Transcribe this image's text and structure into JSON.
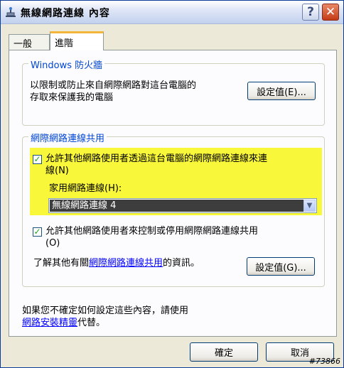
{
  "window": {
    "title": "無線網路連線 內容",
    "icon": "network-icon",
    "help_glyph": "?",
    "close_glyph": "✕"
  },
  "tabs": [
    {
      "label": "一般",
      "selected": false
    },
    {
      "label": "進階",
      "selected": true
    }
  ],
  "firewall": {
    "group_title": "Windows 防火牆",
    "description_line1": "以限制或防止來自網際網路對這台電腦的",
    "description_line2": "存取來保護我的電腦",
    "settings_button": "設定值(E)..."
  },
  "ics": {
    "group_title": "網際網路連線共用",
    "allow_sharing": {
      "checked": true,
      "label_line1": "允許其他網路使用者透過這台電腦的網際網路連線來連",
      "label_line2": "線(N)"
    },
    "home_network": {
      "label": "家用網路連線(H):",
      "selected_value": "無線網路連線 4"
    },
    "allow_control": {
      "checked": true,
      "label_line1": "允許其他網路使用者來控制或停用網際網路連線共用",
      "label_line2": "(O)"
    },
    "info_prefix": "了解其他有關",
    "info_link": "網際網路連線共用",
    "info_suffix": "的資訊。",
    "settings_button": "設定值(G)..."
  },
  "footer": {
    "line1": "如果您不確定如何設定這些內容，請使用",
    "wizard_link": "網路安裝精靈",
    "line2_suffix": "代替。"
  },
  "buttons": {
    "ok": "確定",
    "cancel": "取消"
  },
  "watermark": "#73866",
  "colors": {
    "highlight": "#f9f73a",
    "group_title": "#0046d5",
    "link": "#0000ff",
    "close_button": "#c43b16"
  }
}
